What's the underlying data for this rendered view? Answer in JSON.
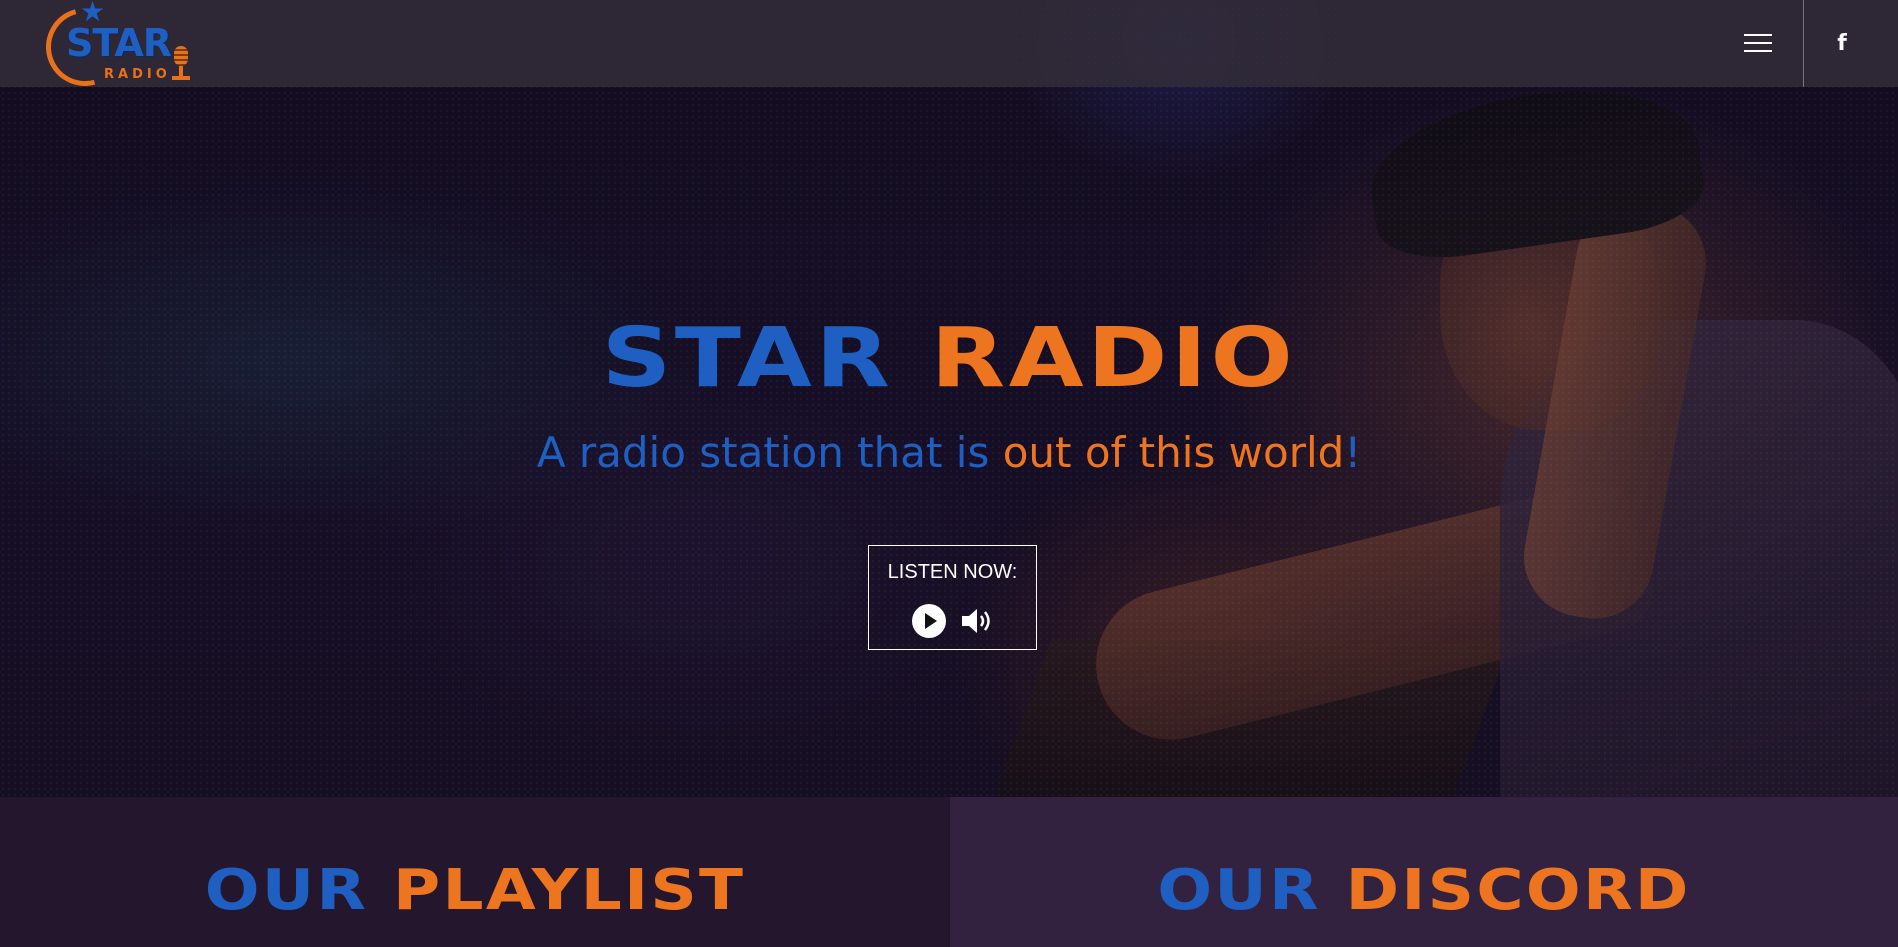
{
  "header": {
    "logo": {
      "word_main": "STAR",
      "word_sub": "RADIO",
      "star_glyph": "★"
    },
    "menu_icon": "hamburger-menu-icon",
    "social_icon": "facebook-icon",
    "social_glyph": "f"
  },
  "hero": {
    "title_part1": "STAR",
    "title_part2": "RADIO",
    "subtitle_part1": "A radio station that is ",
    "subtitle_part2": "out of this world",
    "subtitle_part3": "!",
    "listen_label": "LISTEN NOW:",
    "play_icon": "play-icon",
    "volume_icon": "volume-icon"
  },
  "sections": [
    {
      "title_part1": "OUR",
      "title_part2": "PLAYLIST"
    },
    {
      "title_part1": "OUR",
      "title_part2": "DISCORD"
    }
  ],
  "colors": {
    "brand_blue": "#1f5fc2",
    "brand_orange": "#ee7520",
    "header_bg": "#322d3a",
    "section_left_bg": "#24172d",
    "section_right_bg": "#33223f"
  }
}
